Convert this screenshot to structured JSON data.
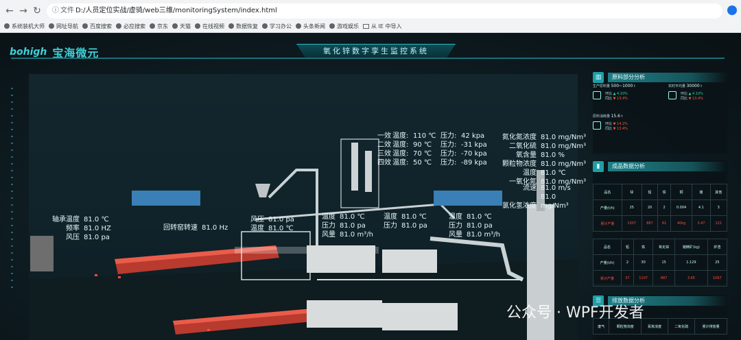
{
  "browser": {
    "info_icon": "info-icon",
    "file_label": "文件",
    "url": "D:/人员定位实战/虚骑/web三维/monitoringSystem/index.html",
    "bookmarks": [
      "系统装机大师",
      "网址导航",
      "百度搜索",
      "必应搜索",
      "京东",
      "天猫",
      "在线视频",
      "数据恢复",
      "学习办公",
      "头条新闻",
      "游戏娱乐",
      "从 IE 中导入"
    ]
  },
  "header": {
    "logo": "bohigh",
    "brand": "宝海微元",
    "title": "氧化锌数字孪生监控系统"
  },
  "scene": {
    "kiln_labels": [
      {
        "k": "轴承温度",
        "v": "81.0 ℃"
      },
      {
        "k": "频率",
        "v": "81.0 HZ"
      },
      {
        "k": "风压",
        "v": "81.0 pa"
      }
    ],
    "kiln_speed": {
      "k": "回转窑转速",
      "v": "81.0 Hz"
    },
    "fan_labels": [
      {
        "k": "风压",
        "v": "81.0 pa"
      },
      {
        "k": "温度",
        "v": "81.0 ℃"
      }
    ],
    "unit1": [
      {
        "k": "温度",
        "v": "81.0 ℃"
      },
      {
        "k": "压力",
        "v": "81.0 pa"
      },
      {
        "k": "风量",
        "v": "81.0 m³/h"
      }
    ],
    "unit2": [
      {
        "k": "温度",
        "v": "81.0 ℃"
      },
      {
        "k": "压力",
        "v": "81.0 pa"
      }
    ],
    "unit3": [
      {
        "k": "温度",
        "v": "81.0 ℃"
      },
      {
        "k": "压力",
        "v": "81.0 pa"
      },
      {
        "k": "风量",
        "v": "81.0 m³/h"
      }
    ],
    "effects": [
      {
        "name": "一效",
        "t": "温度:",
        "tv": "110 ℃",
        "p": "压力:",
        "pv": "42 kpa"
      },
      {
        "name": "二效",
        "t": "温度:",
        "tv": "90 ℃",
        "p": "压力:",
        "pv": "-31 kpa"
      },
      {
        "name": "三效",
        "t": "温度:",
        "tv": "70 ℃",
        "p": "压力:",
        "pv": "-70 kpa"
      },
      {
        "name": "四效",
        "t": "温度:",
        "tv": "50 ℃",
        "p": "压力:",
        "pv": "-89 kpa"
      }
    ],
    "tower": [
      {
        "k": "氮化氮浓度",
        "v": "81.0 mg/Nm³"
      },
      {
        "k": "二氧化硫",
        "v": "81.0 mg/Nm³"
      },
      {
        "k": "氧含量",
        "v": "81.0 %"
      },
      {
        "k": "颗粒物浓度",
        "v": "81.0 mg/Nm³"
      },
      {
        "k": "温度",
        "v": "81.0 ℃"
      },
      {
        "k": "一氧化氮",
        "v": "81.0 mg/Nm³"
      }
    ],
    "tower2": [
      {
        "k": "流速",
        "v": "81.0 m/s"
      },
      {
        "k": "",
        "v": "81.0"
      },
      {
        "k": "氯化氢浓度",
        "v": "mg/Nm³"
      }
    ]
  },
  "panels": {
    "p1": {
      "title": "原料部分分析",
      "stats": [
        {
          "label": "生产原料量",
          "value": "500~1000",
          "unit": "t",
          "r1": "环比",
          "r1v": "4.10%",
          "r2": "同比",
          "r2v": "13.4%"
        },
        {
          "label": "实时平均量",
          "value": "30000",
          "unit": "t",
          "r1": "环比",
          "r1v": "4.10%",
          "r2": "同比",
          "r2v": "13.4%"
        },
        {
          "label": "原料消耗量",
          "value": "15.6",
          "unit": "t",
          "r1": "环比",
          "r1v": "14.2%",
          "r2": "同比",
          "r2v": "13.4%"
        }
      ]
    },
    "p2": {
      "title": "成品数据分析",
      "table1": {
        "head": [
          "品名",
          "锌",
          "铅",
          "铁",
          "铜",
          "锗",
          "其他"
        ],
        "rows": [
          [
            "产量(t/h)",
            "25",
            "20",
            "2",
            "0.004",
            "4.1",
            "3"
          ],
          [
            "累计产量",
            "1307",
            "887",
            "61",
            "40kg",
            "3.47",
            "121"
          ]
        ]
      },
      "table2": {
        "head": [
          "品名",
          "铅",
          "铁",
          "氧化锌",
          "锗精矿(kg)",
          "炉渣"
        ],
        "rows": [
          [
            "产量(t/h)",
            "2",
            "30",
            "15",
            "1.129",
            "25"
          ],
          [
            "累计产量",
            "37",
            "1107",
            "887",
            "3.65",
            "1067"
          ]
        ]
      }
    },
    "p3": {
      "title": "排放数据分析",
      "head": [
        "废气",
        "颗粒物浓度",
        "氮氧浓度",
        "二氧化硫",
        "累计排放量"
      ]
    }
  },
  "watermark": "公众号 · WPF开发者"
}
